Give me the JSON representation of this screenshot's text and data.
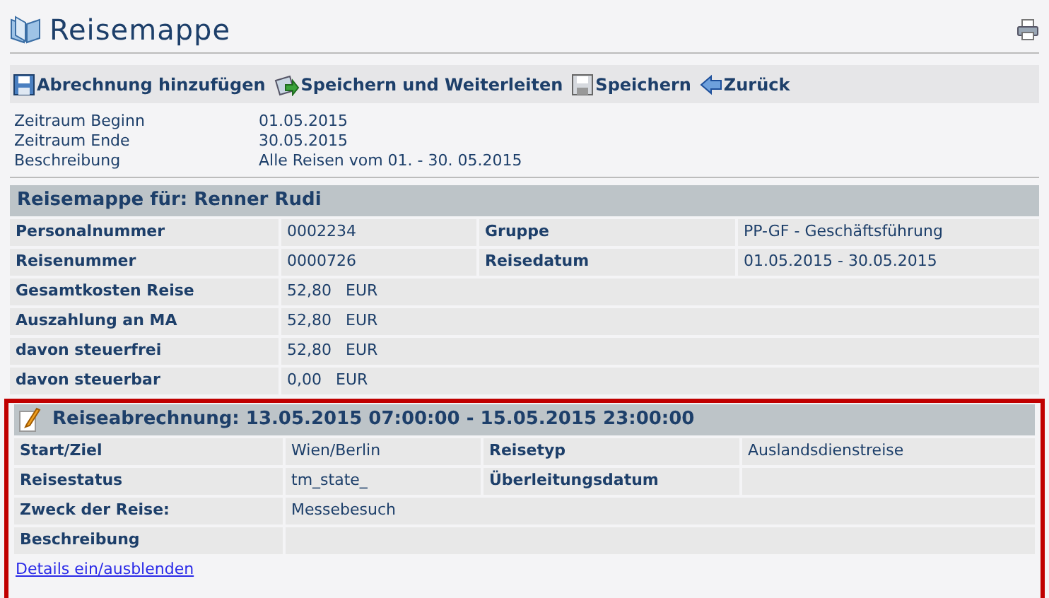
{
  "page": {
    "title": "Reisemappe"
  },
  "toolbar": [
    {
      "kind": "add",
      "label": "Abrechnung hinzufügen"
    },
    {
      "kind": "forward",
      "label": "Speichern und Weiterleiten"
    },
    {
      "kind": "save",
      "label": "Speichern"
    },
    {
      "kind": "back",
      "label": "Zurück"
    }
  ],
  "period": [
    {
      "label": "Zeitraum Beginn",
      "value": "01.05.2015"
    },
    {
      "label": "Zeitraum Ende",
      "value": "30.05.2015"
    },
    {
      "label": "Beschreibung",
      "value": "Alle Reisen vom 01. - 30. 05.2015"
    }
  ],
  "folder": {
    "heading": "Reisemappe für: Renner Rudi",
    "rows": [
      {
        "fields": [
          {
            "label": "Personalnummer",
            "value": "0002234"
          },
          {
            "label": "Gruppe",
            "value": "PP-GF - Geschäftsführung"
          }
        ]
      },
      {
        "fields": [
          {
            "label": "Reisenummer",
            "value": "0000726"
          },
          {
            "label": "Reisedatum",
            "value": "01.05.2015 - 30.05.2015"
          }
        ]
      },
      {
        "fields": [
          {
            "label": "Gesamtkosten Reise",
            "value": "52,80",
            "unit": "EUR"
          }
        ]
      },
      {
        "fields": [
          {
            "label": "Auszahlung an MA",
            "value": "52,80",
            "unit": "EUR"
          }
        ]
      },
      {
        "fields": [
          {
            "label": "davon steuerfrei",
            "value": "52,80",
            "unit": "EUR"
          }
        ]
      },
      {
        "fields": [
          {
            "label": "davon steuerbar",
            "value": "0,00",
            "unit": "EUR"
          }
        ]
      }
    ]
  },
  "trip": {
    "heading": "Reiseabrechnung: 13.05.2015 07:00:00 - 15.05.2015 23:00:00",
    "highlighted": true,
    "rows": [
      {
        "fields": [
          {
            "label": "Start/Ziel",
            "value": "Wien/Berlin"
          },
          {
            "label": "Reisetyp",
            "value": "Auslandsdienstreise"
          }
        ]
      },
      {
        "fields": [
          {
            "label": "Reisestatus",
            "value": "tm_state_"
          },
          {
            "label": "Überleitungsdatum"
          }
        ]
      },
      {
        "fields": [
          {
            "label": "Zweck der Reise:",
            "value": "Messebesuch"
          }
        ]
      },
      {
        "fields": [
          {
            "label": "Beschreibung"
          }
        ]
      }
    ],
    "link": "Details ein/ausblenden"
  }
}
